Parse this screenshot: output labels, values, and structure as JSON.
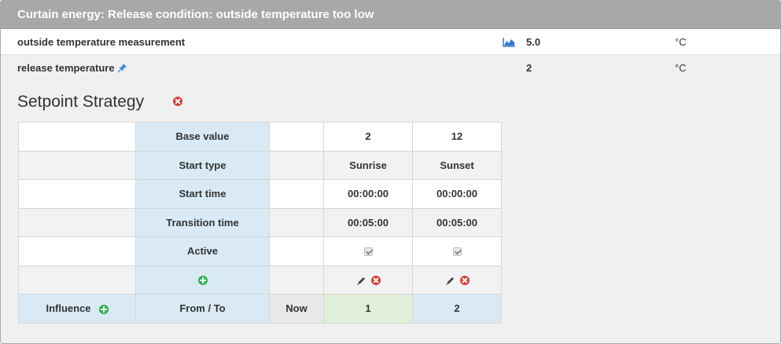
{
  "header": {
    "title": "Curtain energy: Release condition: outside temperature too low"
  },
  "rows": [
    {
      "label": "outside temperature measurement",
      "value": "5.0",
      "unit": "°C",
      "icon": "area-chart-icon"
    },
    {
      "label": "release temperature",
      "value": "2",
      "unit": "°C",
      "icon": "pin-icon"
    }
  ],
  "section": {
    "title": "Setpoint Strategy",
    "remove_icon": "close-circle-icon"
  },
  "table": {
    "rows": [
      {
        "label": "Base value",
        "values": [
          "2",
          "12"
        ]
      },
      {
        "label": "Start type",
        "values": [
          "Sunrise",
          "Sunset"
        ]
      },
      {
        "label": "Start time",
        "values": [
          "00:00:00",
          "00:00:00"
        ]
      },
      {
        "label": "Transition time",
        "values": [
          "00:05:00",
          "00:05:00"
        ]
      },
      {
        "label": "Active",
        "values": [
          "checked",
          "checked"
        ]
      }
    ],
    "actions_row": {
      "add_icon": "add-circle-icon",
      "edit_icon": "pencil-icon",
      "delete_icon": "close-circle-icon"
    },
    "footer": {
      "influence": "Influence",
      "from_to": "From / To",
      "now": "Now",
      "values": [
        "1",
        "2"
      ]
    }
  },
  "colors": {
    "header_bg": "#a8a8a8",
    "highlight_blue": "#d9eaf6",
    "highlight_green": "#e0f0d8",
    "add_green": "#2cb34a",
    "delete_red": "#d9403a",
    "chart_blue": "#3a7bd5"
  }
}
